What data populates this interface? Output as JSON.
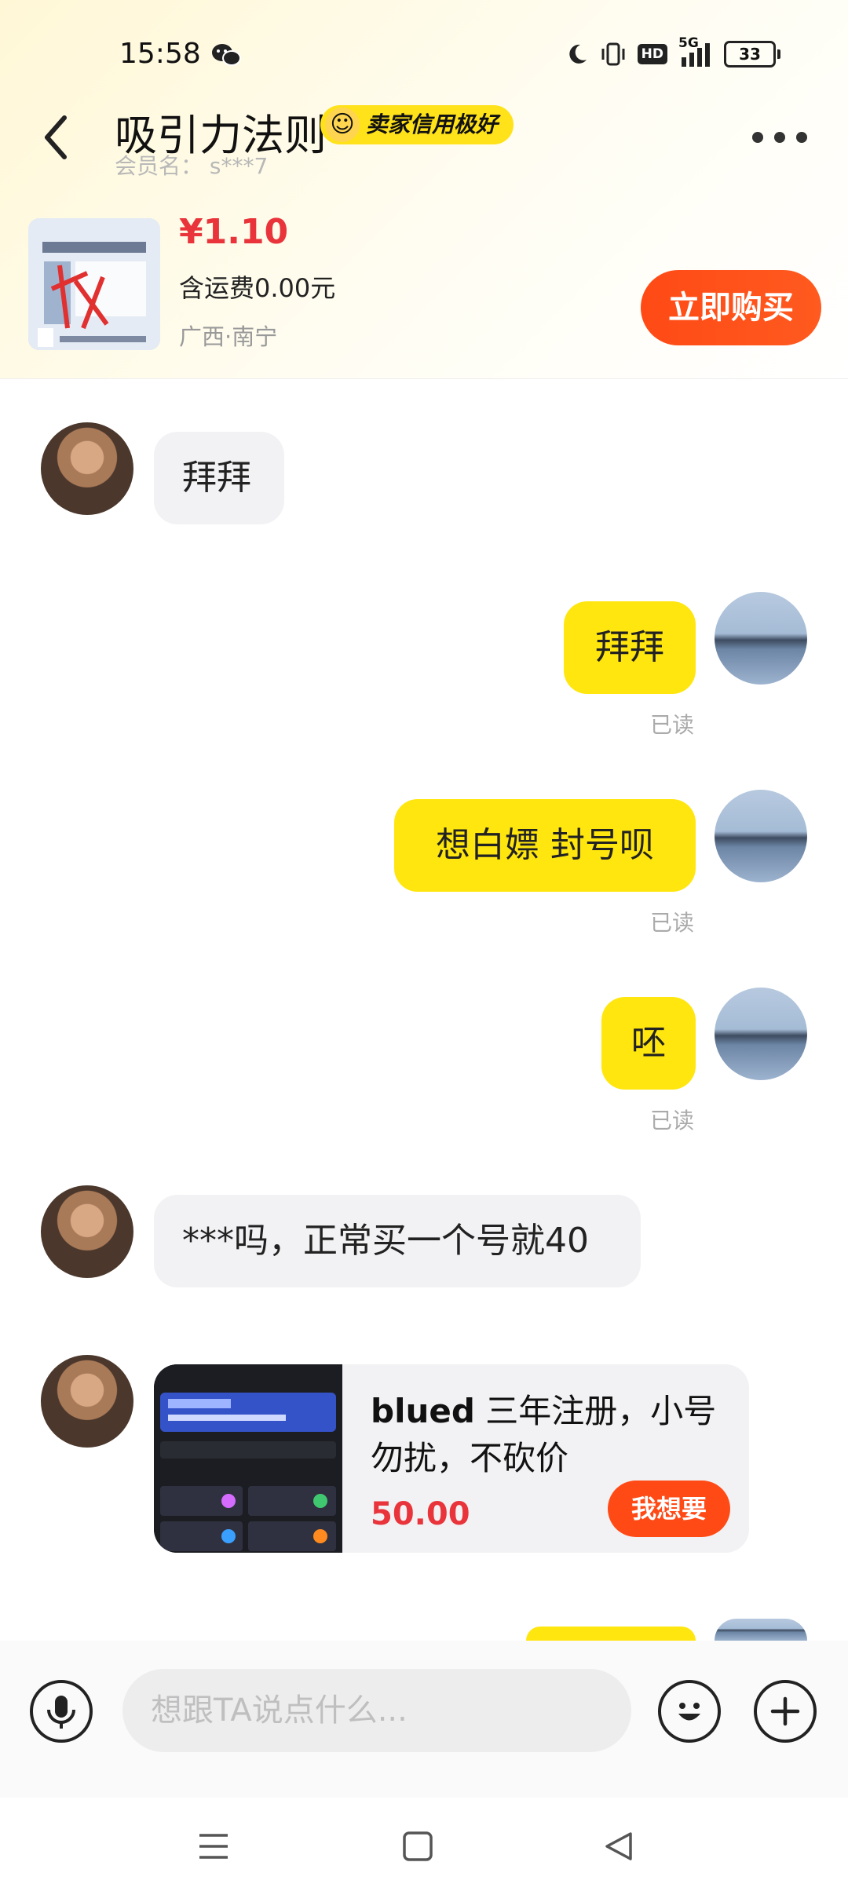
{
  "status_bar": {
    "time": "15:58",
    "network": "5G",
    "hd": "HD",
    "battery": "33"
  },
  "header": {
    "seller_name": "吸引力法则",
    "credit_badge": "卖家信用极好",
    "member_label": "会员名：",
    "member_name": "s***7"
  },
  "product": {
    "price": "¥1.10",
    "shipping": "含运费0.00元",
    "location": "广西·南宁",
    "buy_label": "立即购买"
  },
  "messages": [
    {
      "side": "in",
      "text": "拜拜"
    },
    {
      "side": "out",
      "text": "拜拜",
      "status": "已读"
    },
    {
      "side": "out",
      "text": "想白嫖  封号呗",
      "status": "已读"
    },
    {
      "side": "out",
      "text": "呸",
      "status": "已读"
    },
    {
      "side": "in",
      "text": "***吗，正常买一个号就40"
    }
  ],
  "product_card": {
    "title_bold": "blued",
    "title_rest": " 三年注册，小号勿扰，不砍价",
    "price": "50.00",
    "want_label": "我想要"
  },
  "input": {
    "placeholder": "想跟TA说点什么..."
  },
  "colors": {
    "accent": "#ffe60f",
    "buy": "#ff4a16",
    "price": "#e8343a"
  }
}
